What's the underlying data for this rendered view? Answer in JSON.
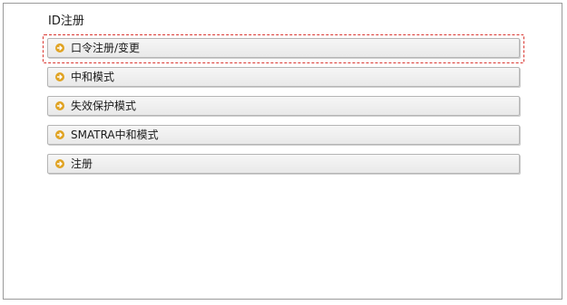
{
  "page": {
    "title": "ID注册"
  },
  "menu": {
    "items": [
      {
        "label": "口令注册/变更",
        "icon": "arrow-right-circle-icon",
        "selected": true
      },
      {
        "label": "中和模式",
        "icon": "arrow-right-circle-icon"
      },
      {
        "label": "失效保护模式",
        "icon": "arrow-right-circle-icon"
      },
      {
        "label": "SMATRA中和模式",
        "icon": "arrow-right-circle-icon"
      },
      {
        "label": "注册",
        "icon": "arrow-right-circle-icon"
      }
    ]
  },
  "colors": {
    "icon": "#e0a323",
    "focus": "#d9352f",
    "border": "#b5b5b5"
  }
}
